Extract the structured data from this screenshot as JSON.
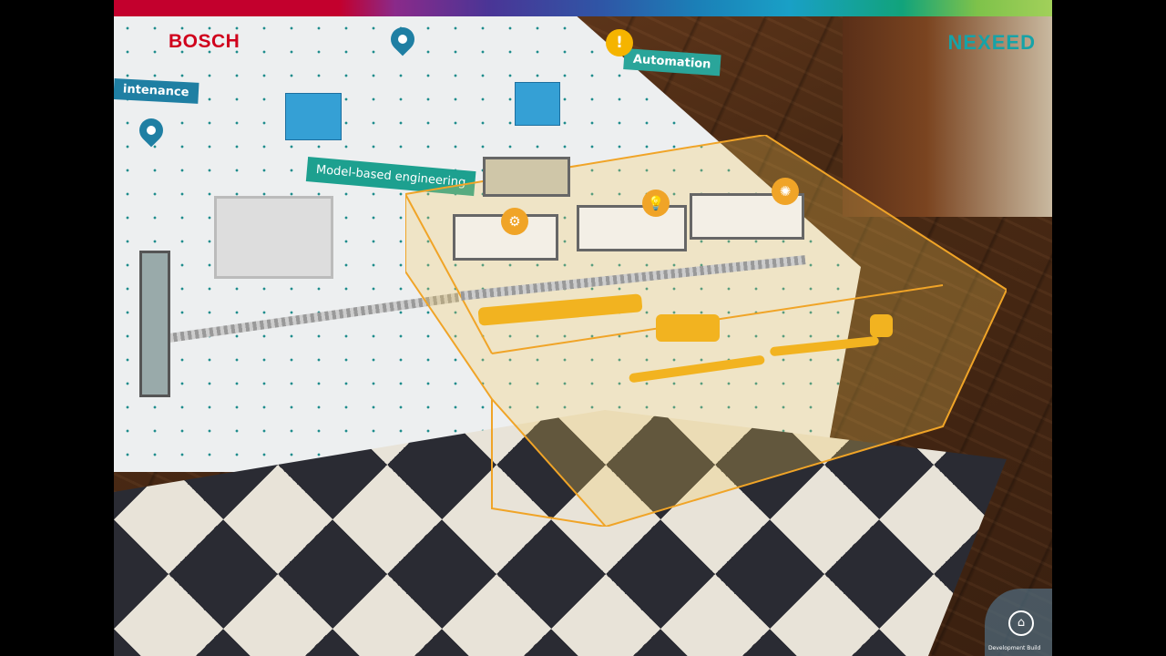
{
  "brand": {
    "left_logo": "BOSCH",
    "right_logo": "NEXEED",
    "left_color": "#d0001c",
    "right_color": "#16a3a8"
  },
  "labels": {
    "maintenance": "intenance",
    "model_based": "Model-based engineering",
    "automation": "Automation"
  },
  "icons": {
    "warning": "warning-icon",
    "robot": "robot-arm-icon",
    "bulb": "lightbulb-icon",
    "gear": "gear-icon",
    "home": "home-icon",
    "pin": "location-pin-icon"
  },
  "home_button": {
    "label": "Development Build"
  },
  "colors": {
    "highlight": "#f0a427",
    "label_teal": "#1da08f",
    "label_blue": "#1f7fa3"
  }
}
